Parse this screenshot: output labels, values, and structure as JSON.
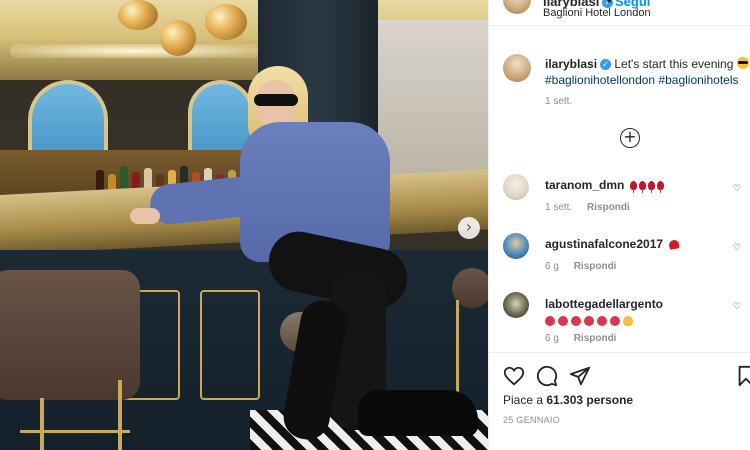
{
  "header": {
    "username": "ilaryblasi",
    "follow_label": "Segui",
    "separator": "•",
    "location": "Baglioni Hotel London"
  },
  "caption": {
    "username": "ilaryblasi",
    "text": "Let's start this evening",
    "hashtags": "#baglionihotellondon #baglionihotels",
    "time": "1 sett."
  },
  "load_more": {
    "icon": "plus-circle-icon",
    "label": "+"
  },
  "comments": [
    {
      "username": "taranom_dmn",
      "emoji": "roses",
      "time": "1 sett.",
      "reply": "Rispondi"
    },
    {
      "username": "agustinafalcone2017",
      "emoji": "heart",
      "time": "6 g",
      "reply": "Rispondi"
    },
    {
      "username": "labottegadellargento",
      "emoji": "faces-clap",
      "time": "6 g",
      "reply": "Rispondi"
    }
  ],
  "actions": {
    "like_icon": "heart-icon",
    "comment_icon": "comment-icon",
    "share_icon": "share-icon",
    "save_icon": "bookmark-icon"
  },
  "likes": {
    "prefix": "Piace a ",
    "count": "61.303 persone"
  },
  "date": "25 GENNAIO",
  "photo": {
    "next_icon": "chevron-right-icon",
    "next_glyph": "›"
  },
  "colors": {
    "link": "#0095f6",
    "hashtag": "#00376b",
    "muted": "#8e8e8e",
    "verified": "#3897f0"
  }
}
